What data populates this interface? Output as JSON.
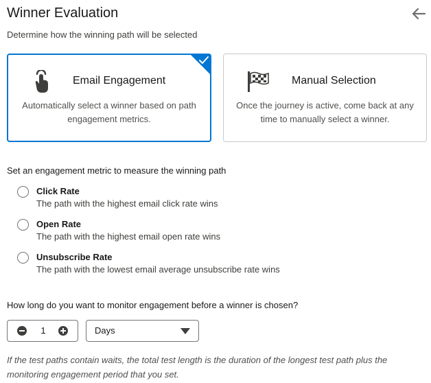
{
  "header": {
    "title": "Winner Evaluation",
    "back_icon": "arrow-left-icon"
  },
  "subtitle": "Determine how the winning path will be selected",
  "cards": [
    {
      "title": "Email Engagement",
      "description": "Automatically select a winner based on path engagement metrics.",
      "icon": "touch-hand-icon",
      "selected": true
    },
    {
      "title": "Manual Selection",
      "description": "Once the journey is active, come back at any time to manually select a winner.",
      "icon": "checkered-flag-icon",
      "selected": false
    }
  ],
  "metric": {
    "heading": "Set an engagement metric to measure the winning path",
    "options": [
      {
        "label": "Click Rate",
        "description": "The path with the highest email click rate wins"
      },
      {
        "label": "Open Rate",
        "description": "The path with the highest email open rate wins"
      },
      {
        "label": "Unsubscribe Rate",
        "description": "The path with the lowest email average unsubscribe rate wins"
      }
    ]
  },
  "monitor": {
    "heading": "How long do you want to monitor engagement before a winner is chosen?",
    "quantity": "1",
    "unit": "Days"
  },
  "footnote": "If the test paths contain waits, the total test length is the duration of the longest test path plus the monitoring engagement period that you set.",
  "colors": {
    "accent": "#0176d3",
    "icon": "#3e3e3c",
    "border": "#c9c9c9"
  }
}
